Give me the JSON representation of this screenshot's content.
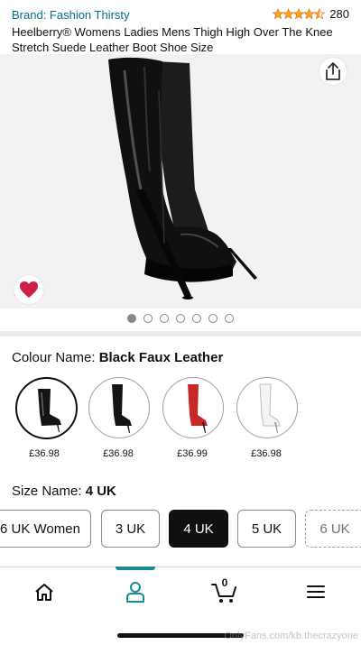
{
  "header": {
    "brand": "Brand: Fashion Thirsty",
    "rating_value": 4.5,
    "rating_count": "280",
    "title": "Heelberry® Womens Ladies Mens Thigh High Over The Knee Stretch Suede Leather Boot Shoe Size"
  },
  "gallery": {
    "total_images": 7,
    "active_index": 0
  },
  "colour": {
    "label": "Colour Name:",
    "selected": "Black Faux Leather",
    "options": [
      {
        "price": "£36.98",
        "color": "#141414"
      },
      {
        "price": "£36.98",
        "color": "#141414"
      },
      {
        "price": "£36.99",
        "color": "#c62828"
      },
      {
        "price": "£36.98",
        "color": "#f4f4f4"
      }
    ]
  },
  "size": {
    "label": "Size Name:",
    "selected": "4 UK",
    "options": [
      "6 UK Women",
      "3 UK",
      "4 UK",
      "5 UK",
      "6 UK"
    ]
  },
  "nav": {
    "cart_count": "0",
    "accent": "#198b96"
  },
  "watermark": "OnlyFans.com/kb.thecrazyone"
}
